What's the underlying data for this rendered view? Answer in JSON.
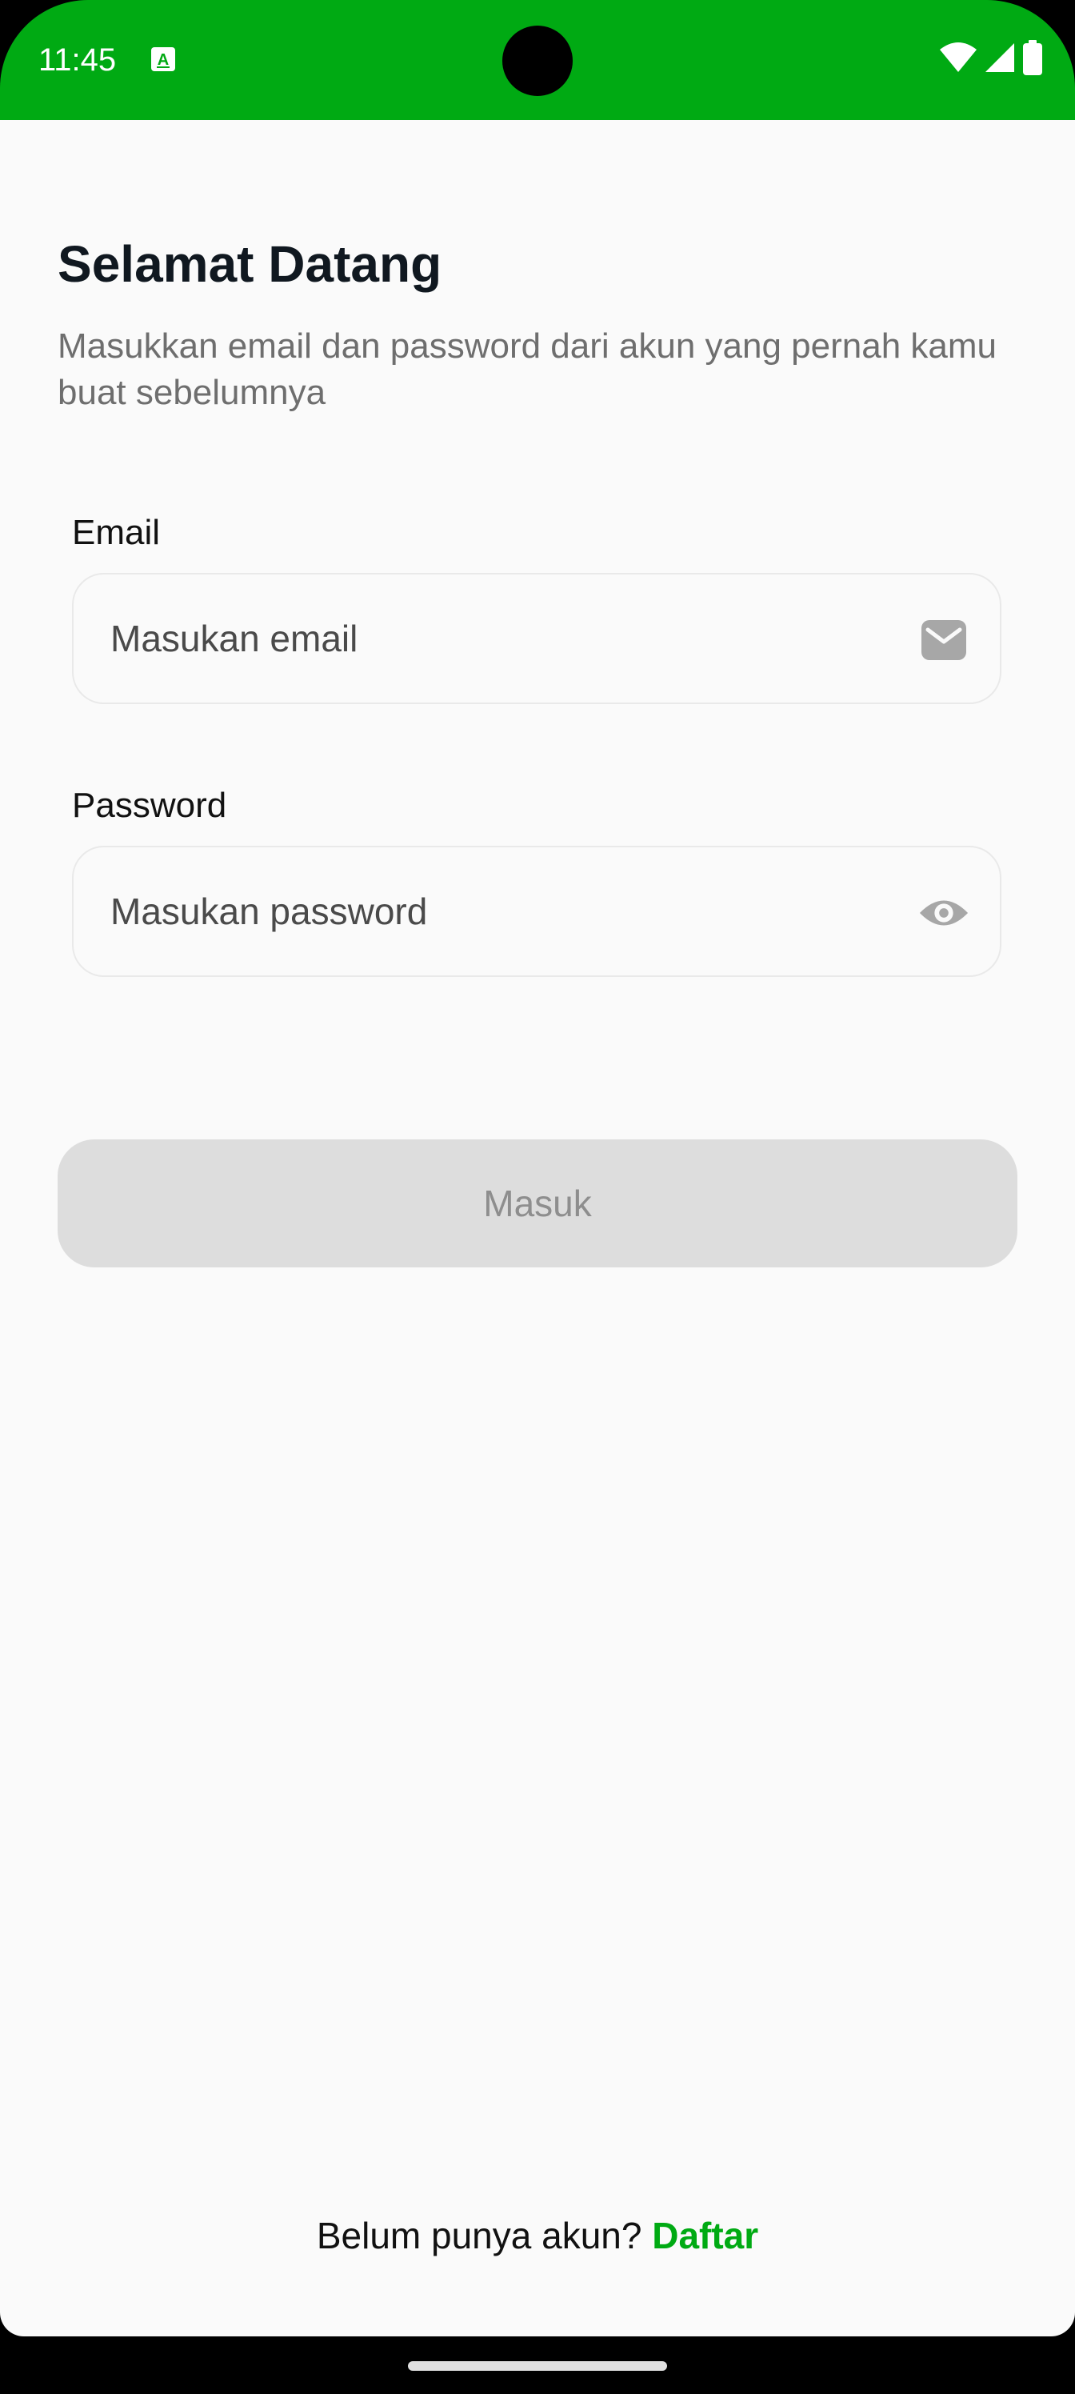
{
  "status_bar": {
    "time": "11:45",
    "app_icon": "a-notification-icon",
    "icons": [
      "wifi-icon",
      "cellular-signal-icon",
      "battery-icon"
    ],
    "color": "#00AA13"
  },
  "header": {
    "title": "Selamat Datang",
    "subtitle": "Masukkan email dan password dari akun yang pernah kamu buat sebelumnya"
  },
  "form": {
    "email": {
      "label": "Email",
      "placeholder": "Masukan email",
      "value": "",
      "icon": "envelope-icon"
    },
    "password": {
      "label": "Password",
      "placeholder": "Masukan password",
      "value": "",
      "icon": "eye-icon"
    },
    "submit_label": "Masuk",
    "submit_enabled": false
  },
  "footer": {
    "prompt": "Belum punya akun?",
    "link_label": "Daftar",
    "link_color": "#00AA13"
  }
}
